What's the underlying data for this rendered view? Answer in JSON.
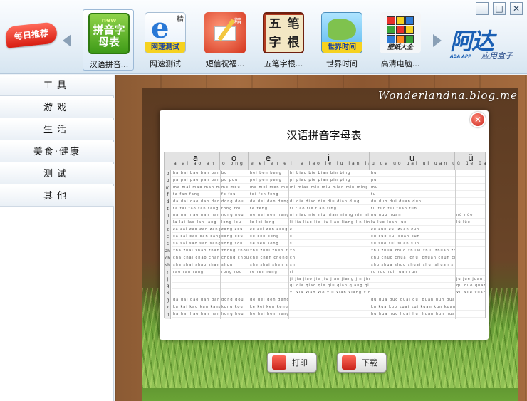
{
  "window": {
    "min_label": "—",
    "max_label": "□",
    "close_label": "✕"
  },
  "header": {
    "daily_label": "每日推荐",
    "apps": [
      {
        "label": "汉语拼音...",
        "icon": "pinyin-icon",
        "icon_text_top": "new",
        "icon_text": "拼音字母表",
        "selected": true
      },
      {
        "label": "网速测试",
        "icon": "ie-speed-icon",
        "icon_text": "网速测试",
        "badge": "精"
      },
      {
        "label": "短信祝福...",
        "icon": "sms-icon",
        "badge": "精"
      },
      {
        "label": "五笔字根...",
        "icon": "wubi-icon",
        "cells": [
          "五",
          "笔",
          "字",
          "根"
        ]
      },
      {
        "label": "世界时间",
        "icon": "globe-icon",
        "icon_text": "世界时间"
      },
      {
        "label": "高清电脑...",
        "icon": "rubik-cube-icon",
        "icon_text": "壁纸大全"
      }
    ],
    "brand": {
      "logo": "阿达",
      "sub1": "ADA APP",
      "sub2": "应用盒子"
    }
  },
  "sidebar": {
    "items": [
      {
        "label": "工具"
      },
      {
        "label": "游戏"
      },
      {
        "label": "生活"
      },
      {
        "label": "美食·健康"
      },
      {
        "label": "测试"
      },
      {
        "label": "其他"
      }
    ]
  },
  "content": {
    "watermark": "Wonderlandna.blog.me",
    "panel_title": "汉语拼音字母表",
    "close_label": "✕",
    "table": {
      "groups": [
        {
          "vowel": "a",
          "finals": "a ai ao an ang"
        },
        {
          "vowel": "o",
          "finals": "o ong ou"
        },
        {
          "vowel": "e",
          "finals": "e ei en eng er"
        },
        {
          "vowel": "i",
          "finals": "i ia iao ie iu ian iang in ing iong"
        },
        {
          "vowel": "u",
          "finals": "u ua uo uai ui uan un uang ueng"
        },
        {
          "vowel": "ü",
          "finals": "ü üe üan ün"
        }
      ],
      "initials": [
        "b",
        "p",
        "m",
        "f",
        "d",
        "t",
        "n",
        "l",
        "z",
        "c",
        "s",
        "zh",
        "ch",
        "sh",
        "r",
        "j",
        "q",
        "x",
        "g",
        "k",
        "h"
      ],
      "rows": [
        {
          "a": "ba bai bao ban bang",
          "o": "bo",
          "e": "bei ben beng",
          "i": "bi biao bie bian bin bing",
          "u": "bu",
          "v": ""
        },
        {
          "a": "pa pai pao pan pang",
          "o": "po pou",
          "e": "pei pen peng",
          "i": "pi piao pie pian pin ping",
          "u": "pu",
          "v": ""
        },
        {
          "a": "ma mai mao man mang",
          "o": "mo mou",
          "e": "me mei men meng",
          "i": "mi miao mie miu mian min ming",
          "u": "mu",
          "v": ""
        },
        {
          "a": "fa fan fang",
          "o": "fo fou",
          "e": "fei fen feng",
          "i": "",
          "u": "fu",
          "v": ""
        },
        {
          "a": "da dai dao dan dang",
          "o": "dong dou",
          "e": "de dei den deng",
          "i": "di dia diao die diu dian ding",
          "u": "du duo dui duan dun",
          "v": ""
        },
        {
          "a": "ta tai tao tan tang",
          "o": "tong tou",
          "e": "te teng",
          "i": "ti tiao tie tian ting",
          "u": "tu tuo tui tuan tun",
          "v": ""
        },
        {
          "a": "na nai nao nan nang",
          "o": "nong nou",
          "e": "ne nei nen neng",
          "i": "ni niao nie niu nian niang nin ning",
          "u": "nu nuo nuan",
          "v": "nü nüe"
        },
        {
          "a": "la lai lao lan lang",
          "o": "long lou",
          "e": "le lei leng",
          "i": "li lia liao lie liu lian liang lin ling",
          "u": "lu luo luan lun",
          "v": "lü lüe"
        },
        {
          "a": "za zai zao zan zang",
          "o": "zong zou",
          "e": "ze zei zen zeng",
          "i": "zi",
          "u": "zu zuo zui zuan zun",
          "v": ""
        },
        {
          "a": "ca cai cao can cang",
          "o": "cong cou",
          "e": "ce cen ceng",
          "i": "ci",
          "u": "cu cuo cui cuan cun",
          "v": ""
        },
        {
          "a": "sa sai sao san sang",
          "o": "song sou",
          "e": "se sen seng",
          "i": "si",
          "u": "su suo sui suan sun",
          "v": ""
        },
        {
          "a": "zha zhai zhao zhan zhang",
          "o": "zhong zhou",
          "e": "zhe zhei zhen zheng",
          "i": "zhi",
          "u": "zhu zhua zhuo zhuai zhui zhuan zhun zhuang",
          "v": ""
        },
        {
          "a": "cha chai chao chan chang",
          "o": "chong chou",
          "e": "che chen cheng",
          "i": "chi",
          "u": "chu chuo chuai chui chuan chun chuang",
          "v": ""
        },
        {
          "a": "sha shai shao shan shang",
          "o": "shou",
          "e": "she shei shen sheng",
          "i": "shi",
          "u": "shu shua shuo shuai shui shuan shun shuang",
          "v": ""
        },
        {
          "a": "rao ran rang",
          "o": "rong rou",
          "e": "re ren reng",
          "i": "ri",
          "u": "ru ruo rui ruan run",
          "v": ""
        },
        {
          "a": "",
          "o": "",
          "e": "",
          "i": "ji jia jiao jie jiu jian jiang jin jing jiong",
          "u": "",
          "v": "ju jue juan jun"
        },
        {
          "a": "",
          "o": "",
          "e": "",
          "i": "qi qia qiao qie qiu qian qiang qin qing qiong",
          "u": "",
          "v": "qu que quan qun"
        },
        {
          "a": "",
          "o": "",
          "e": "",
          "i": "xi xia xiao xie xiu xian xiang xin xing xiong",
          "u": "",
          "v": "xu xue xuan xun"
        },
        {
          "a": "ga gai gao gan gang",
          "o": "gong gou",
          "e": "ge gei gen geng",
          "i": "",
          "u": "gu gua guo guai gui guan gun guang",
          "v": ""
        },
        {
          "a": "ka kai kao kan kang",
          "o": "kong kou",
          "e": "ke kei ken keng",
          "i": "",
          "u": "ku kua kuo kuai kui kuan kun kuang",
          "v": ""
        },
        {
          "a": "ha hai hao han hang",
          "o": "hong hou",
          "e": "he hei hen heng",
          "i": "",
          "u": "hu hua huo huai hui huan hun huang",
          "v": ""
        }
      ]
    },
    "buttons": {
      "print": "打印",
      "download": "下载"
    }
  },
  "colors": {
    "accent": "#1a5fb4",
    "daily": "#d81e12",
    "wood": "#8b5a33",
    "grass": "#6fa63c"
  }
}
